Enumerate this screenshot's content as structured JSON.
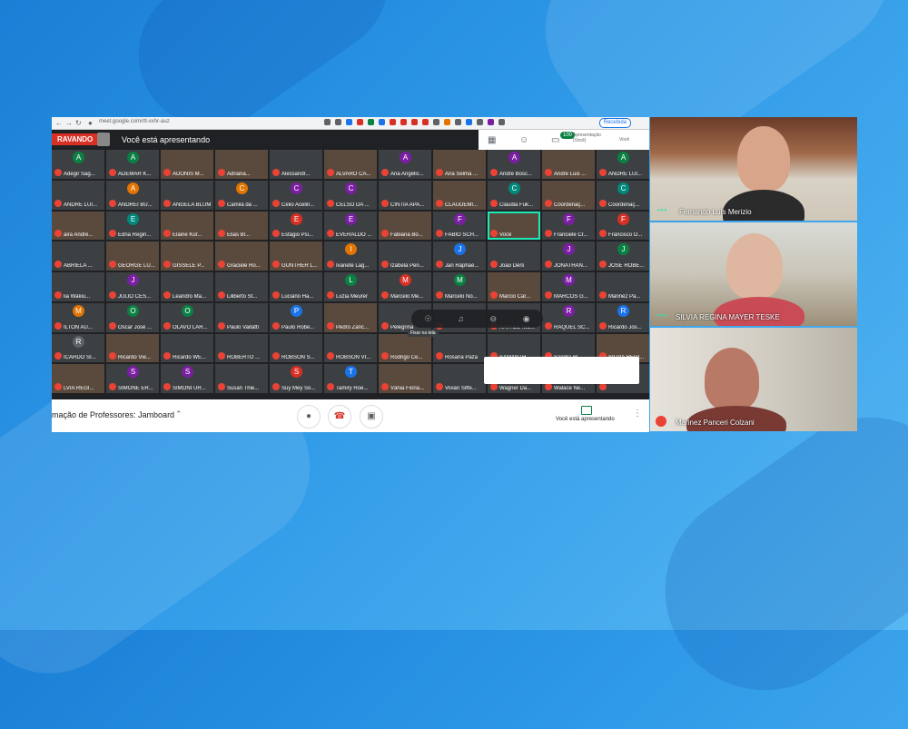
{
  "browser": {
    "url": "meet.google.com/rtl-xxhr-auz",
    "profile_label": "Recebida"
  },
  "meet_header": {
    "recording_label": "RAVANDO",
    "presenting_text": "Você está apresentando",
    "participants_count": "100",
    "presenter_label_line1": "Apresentação",
    "presenter_label_line2": "(Você)",
    "self_label": "Você"
  },
  "participants": [
    {
      "initial": "A",
      "name": "Adegir Sag...",
      "color": "#0b8043",
      "camera": false
    },
    {
      "initial": "A",
      "name": "ADEMAR K...",
      "color": "#0b8043",
      "camera": false
    },
    {
      "initial": "",
      "name": "ADONIS M...",
      "color": "#5f6368",
      "camera": true
    },
    {
      "initial": "",
      "name": "Adriana...",
      "color": "#5f6368",
      "camera": true
    },
    {
      "initial": "",
      "name": "Alessandr...",
      "color": "#5f6368",
      "camera": false
    },
    {
      "initial": "",
      "name": "ALVARO CA...",
      "color": "#5f6368",
      "camera": true
    },
    {
      "initial": "A",
      "name": "Ana Angélic...",
      "color": "#7b1fa2",
      "camera": false
    },
    {
      "initial": "",
      "name": "Ana Selma ...",
      "color": "#5f6368",
      "camera": true
    },
    {
      "initial": "A",
      "name": "André Bosc...",
      "color": "#7b1fa2",
      "camera": false
    },
    {
      "initial": "",
      "name": "Andre Luis ...",
      "color": "#5f6368",
      "camera": true
    },
    {
      "initial": "A",
      "name": "ANDRE LUI...",
      "color": "#0b8043",
      "camera": false
    },
    {
      "initial": "",
      "name": "ANDRE LUI...",
      "color": "#5f6368",
      "camera": false
    },
    {
      "initial": "A",
      "name": "ANDREI BU...",
      "color": "#e37400",
      "camera": false
    },
    {
      "initial": "",
      "name": "ANGELA BLUM",
      "color": "#5f6368",
      "camera": false
    },
    {
      "initial": "C",
      "name": "Camila da ...",
      "color": "#e37400",
      "camera": false
    },
    {
      "initial": "C",
      "name": "Celio Acelin...",
      "color": "#7b1fa2",
      "camera": false
    },
    {
      "initial": "C",
      "name": "CELSO DA ...",
      "color": "#7b1fa2",
      "camera": false
    },
    {
      "initial": "",
      "name": "CINTIA APA...",
      "color": "#5f6368",
      "camera": false
    },
    {
      "initial": "",
      "name": "CLAUDEMI...",
      "color": "#5f6368",
      "camera": true
    },
    {
      "initial": "C",
      "name": "Claudia Fuk...",
      "color": "#00897b",
      "camera": false
    },
    {
      "initial": "",
      "name": "Coordenaç...",
      "color": "#5f6368",
      "camera": true
    },
    {
      "initial": "C",
      "name": "Coordenaç...",
      "color": "#00897b",
      "camera": false
    },
    {
      "initial": "",
      "name": "aira André...",
      "color": "#5f6368",
      "camera": true
    },
    {
      "initial": "E",
      "name": "Edna Regin...",
      "color": "#00897b",
      "camera": false
    },
    {
      "initial": "",
      "name": "Elaine Kür...",
      "color": "#5f6368",
      "camera": true
    },
    {
      "initial": "",
      "name": "Elias Bl...",
      "color": "#5f6368",
      "camera": true
    },
    {
      "initial": "E",
      "name": "Estágio Psi...",
      "color": "#d93025",
      "camera": false
    },
    {
      "initial": "E",
      "name": "EVERALDO ...",
      "color": "#7b1fa2",
      "camera": false
    },
    {
      "initial": "",
      "name": "Fabiana Bo...",
      "color": "#5f6368",
      "camera": true
    },
    {
      "initial": "F",
      "name": "FABIO SCH...",
      "color": "#7b1fa2",
      "camera": false
    },
    {
      "initial": "",
      "name": "Você",
      "color": "#5f6368",
      "camera": true
    },
    {
      "initial": "F",
      "name": "Franciele Cr...",
      "color": "#7b1fa2",
      "camera": false
    },
    {
      "initial": "F",
      "name": "Francisco O...",
      "color": "#d93025",
      "camera": false
    },
    {
      "initial": "",
      "name": "ABRIELA ...",
      "color": "#5f6368",
      "camera": false
    },
    {
      "initial": "",
      "name": "GEORGE LU...",
      "color": "#5f6368",
      "camera": true
    },
    {
      "initial": "",
      "name": "GISSELE P...",
      "color": "#5f6368",
      "camera": true
    },
    {
      "initial": "",
      "name": "Graciele Ro...",
      "color": "#5f6368",
      "camera": true
    },
    {
      "initial": "",
      "name": "GUNTHER L...",
      "color": "#5f6368",
      "camera": true
    },
    {
      "initial": "I",
      "name": "Ivanete Lag...",
      "color": "#e37400",
      "camera": false
    },
    {
      "initial": "",
      "name": "Izabela Pen...",
      "color": "#5f6368",
      "camera": false
    },
    {
      "initial": "J",
      "name": "Jan Raphae...",
      "color": "#1a73e8",
      "camera": false
    },
    {
      "initial": "",
      "name": "João Derli",
      "color": "#5f6368",
      "camera": false
    },
    {
      "initial": "J",
      "name": "JONATHAN...",
      "color": "#7b1fa2",
      "camera": false
    },
    {
      "initial": "J",
      "name": "JOSE ROBE...",
      "color": "#0b8043",
      "camera": false
    },
    {
      "initial": "",
      "name": "lia Wakiu...",
      "color": "#5f6368",
      "camera": false
    },
    {
      "initial": "J",
      "name": "JULIO CES...",
      "color": "#7b1fa2",
      "camera": false
    },
    {
      "initial": "",
      "name": "Leandro Ma...",
      "color": "#5f6368",
      "camera": false
    },
    {
      "initial": "",
      "name": "Liliberto St...",
      "color": "#5f6368",
      "camera": false
    },
    {
      "initial": "",
      "name": "Luciano Ha...",
      "color": "#5f6368",
      "camera": false
    },
    {
      "initial": "L",
      "name": "Luzia Meurer",
      "color": "#0b8043",
      "camera": false
    },
    {
      "initial": "M",
      "name": "Marcelo Me...",
      "color": "#d93025",
      "camera": false
    },
    {
      "initial": "M",
      "name": "Marcelo No...",
      "color": "#0b8043",
      "camera": false
    },
    {
      "initial": "",
      "name": "Marcio Car...",
      "color": "#5f6368",
      "camera": true
    },
    {
      "initial": "M",
      "name": "MARCOS G...",
      "color": "#7b1fa2",
      "camera": false
    },
    {
      "initial": "",
      "name": "Marinez Pa...",
      "color": "#5f6368",
      "camera": false
    },
    {
      "initial": "M",
      "name": "ILTON AU...",
      "color": "#e37400",
      "camera": false
    },
    {
      "initial": "O",
      "name": "Oscar José ...",
      "color": "#0b8043",
      "camera": false
    },
    {
      "initial": "O",
      "name": "OLAVO LAR...",
      "color": "#0b8043",
      "camera": false
    },
    {
      "initial": "",
      "name": "Paulo Vaitatti",
      "color": "#5f6368",
      "camera": false
    },
    {
      "initial": "P",
      "name": "Paulo Robe...",
      "color": "#1a73e8",
      "camera": false
    },
    {
      "initial": "",
      "name": "Pedro Zanc...",
      "color": "#5f6368",
      "camera": true
    },
    {
      "initial": "",
      "name": "Pelegrina",
      "color": "#5f6368",
      "camera": false
    },
    {
      "initial": "",
      "name": "",
      "color": "#5f6368",
      "camera": false
    },
    {
      "initial": "",
      "name": "RAFAEL NIE...",
      "color": "#5f6368",
      "camera": false
    },
    {
      "initial": "R",
      "name": "RAQUEL SC...",
      "color": "#7b1fa2",
      "camera": false
    },
    {
      "initial": "R",
      "name": "Ricardo Jos...",
      "color": "#1a73e8",
      "camera": false
    },
    {
      "initial": "R",
      "name": "ICARDO SI...",
      "color": "#5f6368",
      "camera": false
    },
    {
      "initial": "",
      "name": "Ricardo Vie...",
      "color": "#5f6368",
      "camera": true
    },
    {
      "initial": "",
      "name": "Ricardo WE...",
      "color": "#5f6368",
      "camera": false
    },
    {
      "initial": "",
      "name": "ROBERTO ...",
      "color": "#5f6368",
      "camera": false
    },
    {
      "initial": "",
      "name": "ROBSON S...",
      "color": "#5f6368",
      "camera": false
    },
    {
      "initial": "",
      "name": "ROBSON VI...",
      "color": "#1a73e8",
      "camera": false
    },
    {
      "initial": "",
      "name": "Rodrigo Ce...",
      "color": "#5f6368",
      "camera": true
    },
    {
      "initial": "",
      "name": "Rosana Paza",
      "color": "#5f6368",
      "camera": false
    },
    {
      "initial": "",
      "name": "SAMANTH...",
      "color": "#5f6368",
      "camera": false
    },
    {
      "initial": "",
      "name": "Sandra Bl...",
      "color": "#5f6368",
      "camera": false
    },
    {
      "initial": "",
      "name": "SILVIA REGI...",
      "color": "#5f6368",
      "camera": true
    },
    {
      "initial": "",
      "name": "LVIA REGI...",
      "color": "#5f6368",
      "camera": true
    },
    {
      "initial": "S",
      "name": "SIMONE ER...",
      "color": "#7b1fa2",
      "camera": false
    },
    {
      "initial": "S",
      "name": "SIMONI UR...",
      "color": "#7b1fa2",
      "camera": false
    },
    {
      "initial": "",
      "name": "Susan Thie...",
      "color": "#5f6368",
      "camera": false
    },
    {
      "initial": "S",
      "name": "Suy Mey So...",
      "color": "#d93025",
      "camera": false
    },
    {
      "initial": "T",
      "name": "Tamiry Roe...",
      "color": "#1a73e8",
      "camera": false
    },
    {
      "initial": "",
      "name": "Vânia Fioria...",
      "color": "#5f6368",
      "camera": true
    },
    {
      "initial": "",
      "name": "Vivian Siffe...",
      "color": "#5f6368",
      "camera": false
    },
    {
      "initial": "",
      "name": "Wagner Da...",
      "color": "#5f6368",
      "camera": false
    },
    {
      "initial": "",
      "name": "Walace Ne...",
      "color": "#5f6368",
      "camera": false
    },
    {
      "initial": "",
      "name": "",
      "color": "#5f6368",
      "camera": false
    }
  ],
  "hover": {
    "tooltip": "Fixar na tela"
  },
  "bottom_bar": {
    "meeting_name": "mação de Professores: Jamboard",
    "presenting_label": "Você está apresentando"
  },
  "camera_tiles": [
    {
      "name": "Fernando Luís Merizio"
    },
    {
      "name": "SILVIA REGINA MAYER TESKE"
    },
    {
      "name": "Marinez Panceri Colzani"
    }
  ],
  "colors": {
    "accent_green": "#1de9b6",
    "mute_red": "#ea4335",
    "recording_red": "#d93025",
    "background_blue": "#2f9ae8"
  }
}
